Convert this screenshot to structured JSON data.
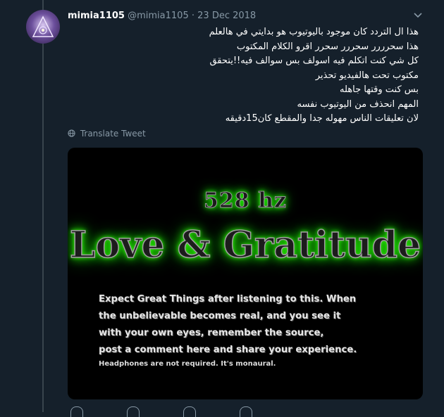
{
  "tweet": {
    "display_name": "mimia1105",
    "handle": "@mimia1105",
    "separator": "·",
    "date": "23 Dec 2018",
    "lines": [
      "هذا ال التردد كان موجود باليوتيوب هو بدايتي في هالعلم",
      "هذا سحرررر سحررر سحرر اقرو الكلام المكتوب",
      "كل شي كنت اتكلم فيه اسولف بس سوالف فيه!!يتحقق",
      "مكتوب تحت هالفيديو تحذير",
      "بس كنت وقتها جاهله",
      "المهم انحذف من اليوتيوب نفسه",
      "لان تعليقات الناس مهوله جدا والمقطع كان15دقيقه"
    ],
    "translate_label": "Translate Tweet"
  },
  "media": {
    "hz_text": "528 hz",
    "title_text": "Love & Gratitude",
    "body_lines": [
      "Expect Great Things after listening to this.  When",
      "the unbelievable becomes real, and you see it",
      "with your own eyes, remember the source,",
      "post a comment here and share your experience."
    ],
    "footnote": "Headphones are not required.  It's monaural."
  },
  "icons": {
    "caret": "chevron-down-icon",
    "translate": "globe-icon"
  },
  "colors": {
    "background": "#15202b",
    "secondary_text": "#8899a6",
    "glow": "#22ff00"
  }
}
